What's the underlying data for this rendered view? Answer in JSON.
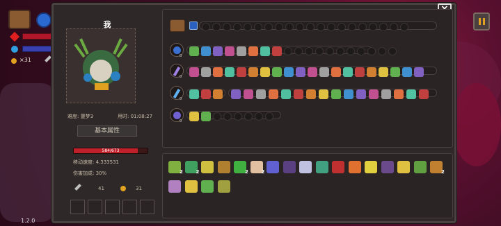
{
  "hud": {
    "coins": "×31",
    "version": "1.2.0",
    "pause_icon": "pause-icon",
    "close_icon": "close-icon"
  },
  "panel": {
    "player_name": "我",
    "difficulty": "难度: 噩梦3",
    "time": "用时: 01:08:27",
    "section_title": "基本属性",
    "hp": "584/673",
    "hp_fraction": 0.868,
    "move_speed": "移动速度: 4.333531",
    "damage_bonus": "伤害加成: 30%",
    "keys": "41",
    "coins": "31"
  },
  "weapons": [
    {
      "icon": "chest-icon",
      "level": "",
      "slots": 20
    },
    {
      "icon": "blue-orb-icon",
      "level": "0",
      "slots": 11
    },
    {
      "icon": "magic-staff-icon",
      "level": "0",
      "slots": 0
    },
    {
      "icon": "ice-wand-icon",
      "level": "0",
      "slots": 0
    },
    {
      "icon": "purple-gem-icon",
      "level": "0",
      "slots": 5
    }
  ],
  "equipment": {
    "row1": [
      "2",
      "2",
      "",
      "",
      "2",
      "2",
      "",
      "",
      "",
      "",
      "",
      "",
      "",
      "",
      "",
      "",
      "2"
    ],
    "row2": [
      "",
      "",
      "",
      ""
    ]
  },
  "colors": {
    "hp_bar": "#c0202a",
    "panel_bg": "#2e2828",
    "accent_gold": "#e0a020"
  }
}
